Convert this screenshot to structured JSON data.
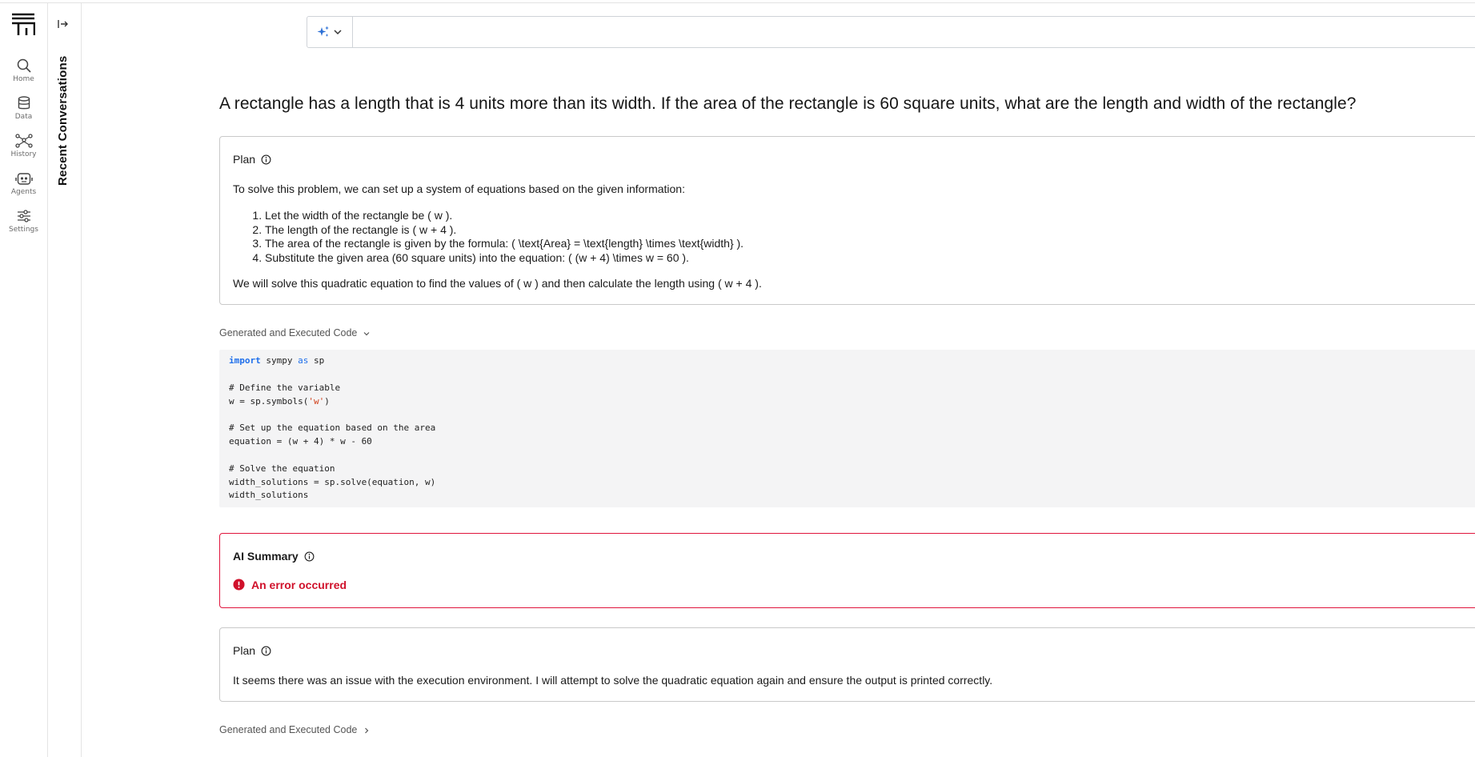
{
  "nav": {
    "items": [
      {
        "label": "Home",
        "icon": "search-icon"
      },
      {
        "label": "Data",
        "icon": "database-icon"
      },
      {
        "label": "History",
        "icon": "history-icon"
      },
      {
        "label": "Agents",
        "icon": "robot-icon"
      },
      {
        "label": "Settings",
        "icon": "sliders-icon"
      }
    ]
  },
  "recent": {
    "title": "Recent Conversations"
  },
  "search": {
    "value": "",
    "placeholder": ""
  },
  "question": "A rectangle has a length that is 4 units more than its width. If the area of the rectangle is 60 square units, what are the length and width of the rectangle?",
  "plan1": {
    "title": "Plan",
    "intro": "To solve this problem, we can set up a system of equations based on the given information:",
    "steps": [
      "Let the width of the rectangle be ( w ).",
      "The length of the rectangle is ( w + 4 ).",
      "The area of the rectangle is given by the formula: ( \\text{Area} = \\text{length} \\times \\text{width} ).",
      "Substitute the given area (60 square units) into the equation: ( (w + 4) \\times w = 60 )."
    ],
    "outro": "We will solve this quadratic equation to find the values of ( w ) and then calculate the length using ( w + 4 )."
  },
  "code1": {
    "toggle_label": "Generated and Executed Code",
    "lines": {
      "l1_kw": "import",
      "l1_mid": " sympy ",
      "l1_kw2": "as",
      "l1_end": " sp",
      "l3": "# Define the variable",
      "l4_start": "w = sp.symbols(",
      "l4_str": "'w'",
      "l4_end": ")",
      "l6": "# Set up the equation based on the area",
      "l7": "equation = (w + 4) * w - 60",
      "l9": "# Solve the equation",
      "l10": "width_solutions = sp.solve(equation, w)",
      "l11": "width_solutions"
    }
  },
  "summary": {
    "title": "AI Summary",
    "error": "An error occurred",
    "accent": "#e0143c"
  },
  "plan2": {
    "title": "Plan",
    "body": "It seems there was an issue with the execution environment. I will attempt to solve the quadratic equation again and ensure the output is printed correctly."
  },
  "code2": {
    "toggle_label": "Generated and Executed Code"
  }
}
